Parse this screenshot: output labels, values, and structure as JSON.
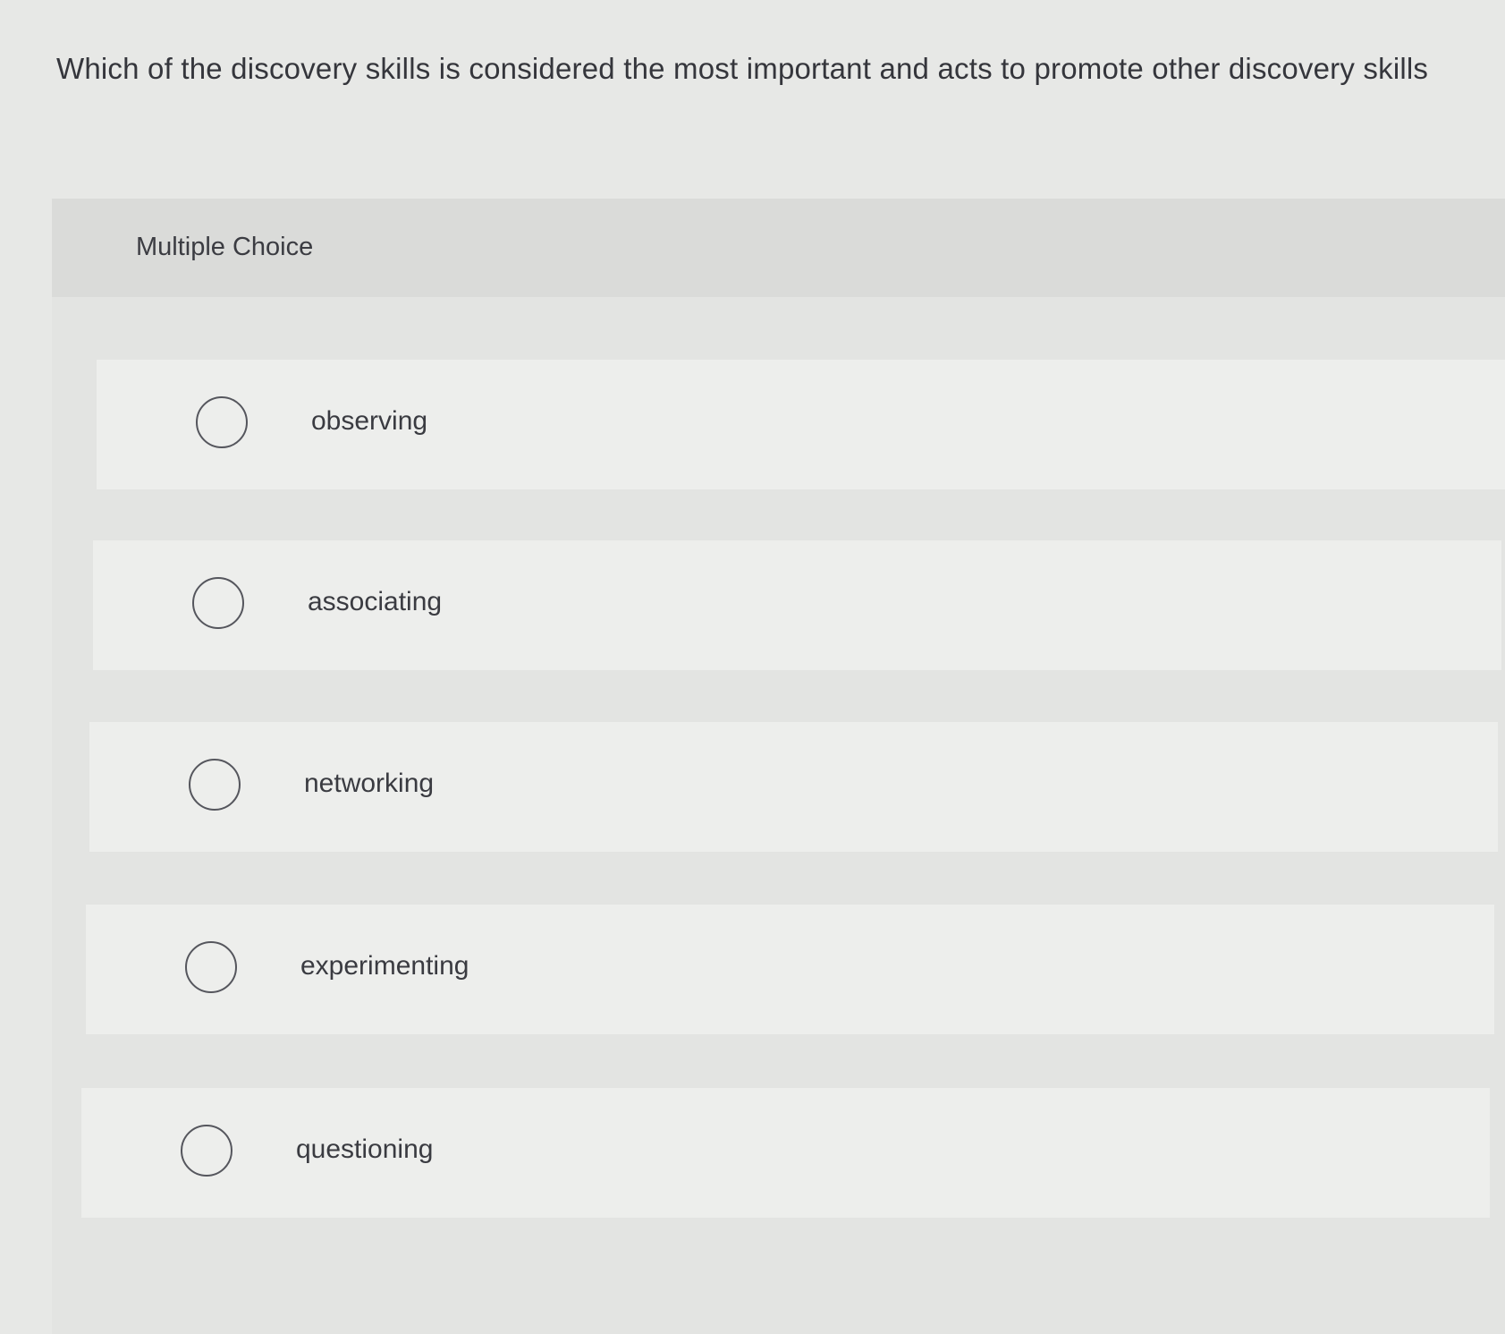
{
  "question": {
    "text": "Which of the discovery skills is considered the most important and acts to promote other discovery skills"
  },
  "panel": {
    "title": "Multiple Choice"
  },
  "options": [
    {
      "label": "observing",
      "selected": false
    },
    {
      "label": "associating",
      "selected": false
    },
    {
      "label": "networking",
      "selected": false
    },
    {
      "label": "experimenting",
      "selected": false
    },
    {
      "label": "questioning",
      "selected": false
    }
  ],
  "colors": {
    "background": "#e7e8e6",
    "panel": "#dcdddb",
    "option": "#edeeec",
    "text": "#3a3a40",
    "radio_border": "#55565d"
  }
}
